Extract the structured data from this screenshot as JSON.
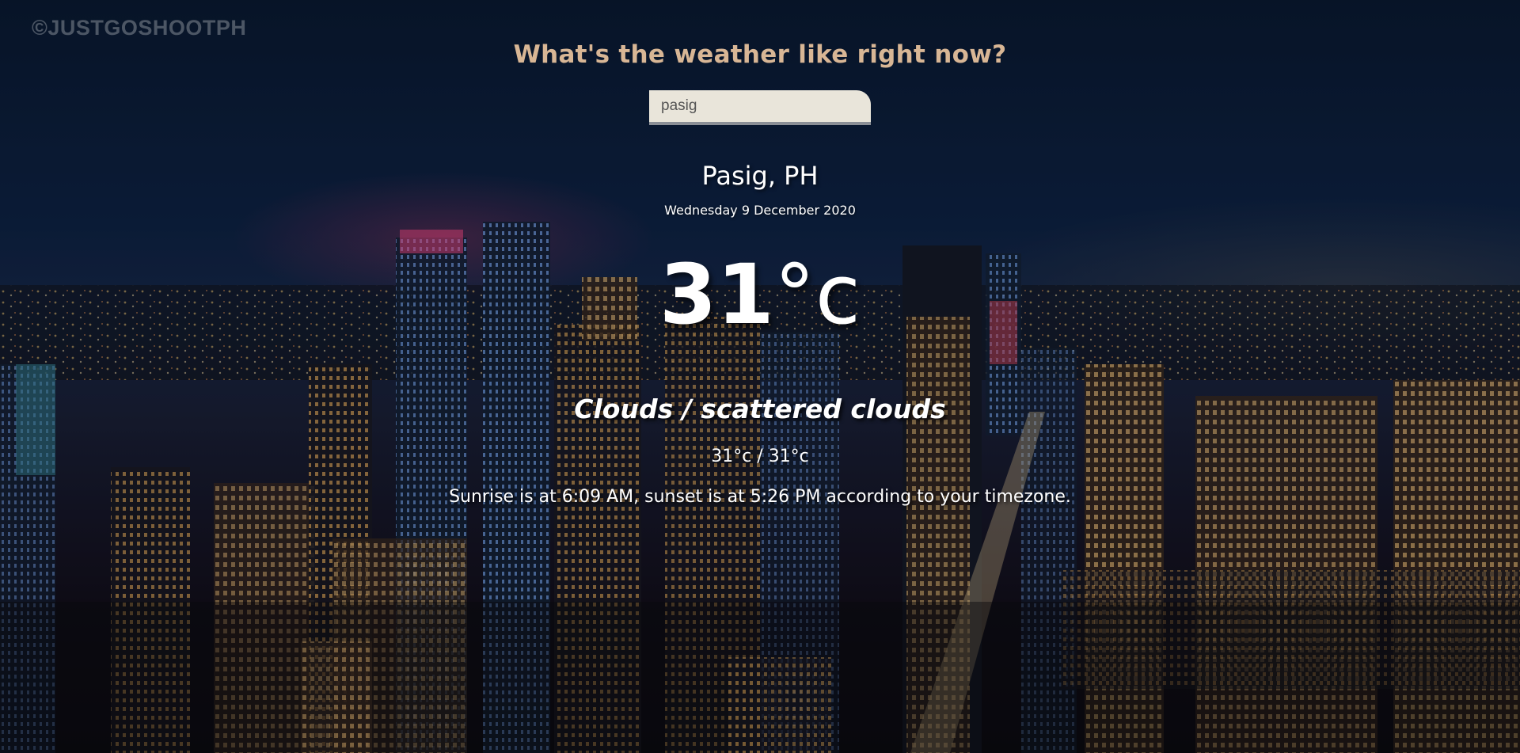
{
  "watermark": "©JUSTGOSHOOTPH",
  "heading": "What's the weather like right now?",
  "search": {
    "value": "pasig",
    "placeholder": ""
  },
  "location": "Pasig, PH",
  "date": "Wednesday 9 December 2020",
  "temperature": {
    "value": "31",
    "unit": "°c"
  },
  "condition": "Clouds / scattered clouds",
  "hi_lo": "31°c / 31°c",
  "sun_times": "Sunrise is at 6:09 AM, sunset is at 5:26 PM according to your timezone.",
  "colors": {
    "heading": "#d8b695",
    "text": "#ffffff",
    "input_bg": "#f5f0e4",
    "input_border": "#8b8f96"
  }
}
